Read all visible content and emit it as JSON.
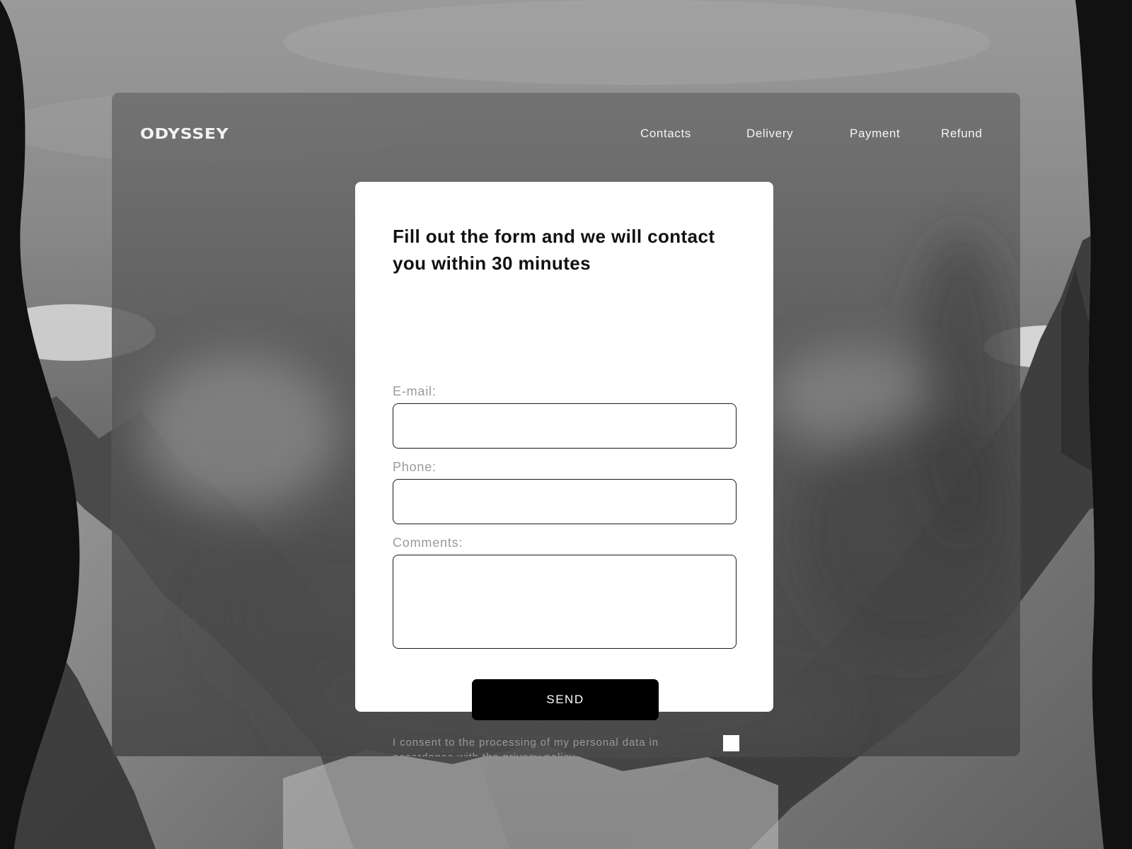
{
  "brand": {
    "logo_text": "ODYSSEY"
  },
  "nav": {
    "items": [
      {
        "label": "Contacts"
      },
      {
        "label": "Delivery"
      },
      {
        "label": "Payment"
      },
      {
        "label": "Refund"
      }
    ]
  },
  "form": {
    "title": "Fill out the form and we will contact you within 30 minutes",
    "email": {
      "label": "E-mail:",
      "value": "",
      "placeholder": ""
    },
    "phone": {
      "label": "Phone:",
      "value": "",
      "placeholder": ""
    },
    "comments": {
      "label": "Comments:",
      "value": "",
      "placeholder": ""
    },
    "send_label": "SEND",
    "consent": {
      "text": "I consent to the processing of my personal data in accordance with the privacy policy",
      "checked": false
    }
  },
  "colors": {
    "page_background": "#111111",
    "card_background": "#ffffff",
    "button_background": "#000000",
    "label_text": "#9a9a9a"
  },
  "icons": [
    "consent-checkbox"
  ]
}
